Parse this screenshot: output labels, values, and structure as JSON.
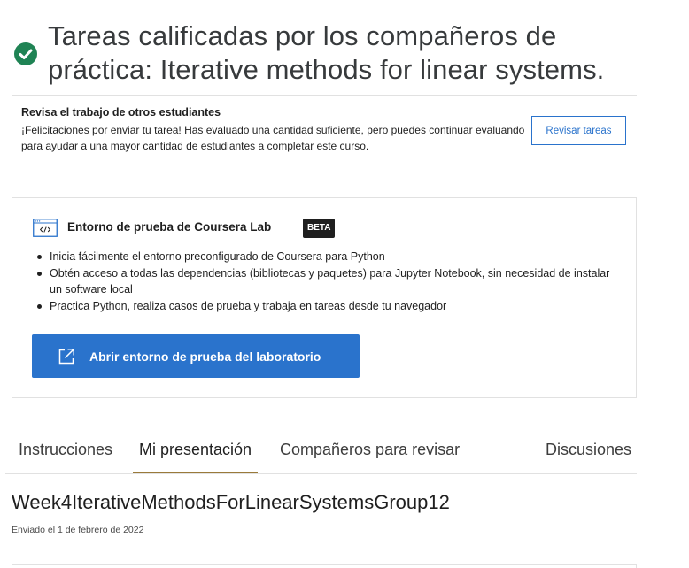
{
  "header": {
    "title": "Tareas calificadas por los compañeros de práctica: Iterative methods for linear systems."
  },
  "review": {
    "heading": "Revisa el trabajo de otros estudiantes",
    "text": "¡Felicitaciones por enviar tu tarea! Has evaluado una cantidad suficiente, pero puedes continuar evaluando para ayudar a una mayor cantidad de estudiantes a completar este curso.",
    "button_label": "Revisar tareas"
  },
  "lab": {
    "title": "Entorno de prueba de Coursera Lab",
    "badge": "BETA",
    "bullets": [
      "Inicia fácilmente el entorno preconfigurado de Coursera para Python",
      "Obtén acceso a todas las dependencias (bibliotecas y paquetes) para Jupyter Notebook, sin necesidad de instalar un software local",
      "Practica Python, realiza casos de prueba y trabaja en tareas desde tu navegador"
    ],
    "button_label": "Abrir entorno de prueba del laboratorio"
  },
  "tabs": [
    {
      "label": "Instrucciones",
      "active": false
    },
    {
      "label": "Mi presentación",
      "active": true
    },
    {
      "label": "Compañeros para revisar",
      "active": false
    },
    {
      "label": "Discusiones",
      "active": false
    }
  ],
  "submission": {
    "title": "Week4IterativeMethodsForLinearSystemsGroup12",
    "date": "Enviado el 1 de febrero de 2022"
  },
  "colors": {
    "accent": "#2a73cc",
    "success": "#1f8354",
    "tab_underline": "#9a7a3a"
  },
  "icons": {
    "status": "check-circle-icon",
    "lab": "code-window-icon",
    "open": "external-link-icon"
  }
}
